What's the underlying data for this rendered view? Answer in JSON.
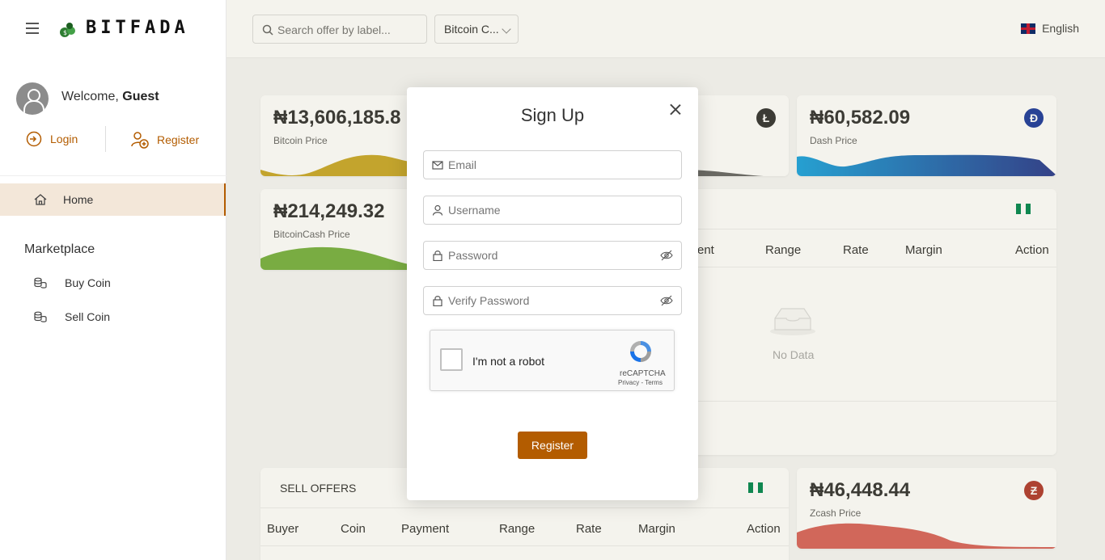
{
  "header": {
    "brand": "BITFADA",
    "search_placeholder": "Search offer by label...",
    "coin_select": "Bitcoin C...",
    "language": "English"
  },
  "sidebar": {
    "welcome_prefix": "Welcome, ",
    "welcome_user": "Guest",
    "login_label": "Login",
    "register_label": "Register",
    "home_label": "Home",
    "marketplace_title": "Marketplace",
    "buy_label": "Buy Coin",
    "sell_label": "Sell Coin"
  },
  "prices": {
    "bitcoin": {
      "value": "₦13,606,185.8",
      "label": "Bitcoin Price"
    },
    "litecoin": {
      "badge": "Ł"
    },
    "dash": {
      "value": "₦60,582.09",
      "label": "Dash Price",
      "badge": "Đ"
    },
    "bitcoincash": {
      "value": "₦214,249.32",
      "label": "BitcoinCash Price"
    },
    "zcash": {
      "value": "₦46,448.44",
      "label": "Zcash Price",
      "badge": "Ƶ"
    }
  },
  "buy_panel": {
    "col_payment_partial": "ent",
    "col_range": "Range",
    "col_rate": "Rate",
    "col_margin": "Margin",
    "col_action": "Action",
    "no_data": "No Data"
  },
  "sell_panel": {
    "title": "SELL OFFERS",
    "col_buyer": "Buyer",
    "col_coin": "Coin",
    "col_payment": "Payment",
    "col_range": "Range",
    "col_rate": "Rate",
    "col_margin": "Margin",
    "col_action": "Action"
  },
  "modal": {
    "title": "Sign Up",
    "email_placeholder": "Email",
    "username_placeholder": "Username",
    "password_placeholder": "Password",
    "verify_placeholder": "Verify Password",
    "captcha_text": "I'm not a robot",
    "captcha_brand": "reCAPTCHA",
    "captcha_terms": "Privacy - Terms",
    "register_button": "Register"
  },
  "colors": {
    "accent": "#b35c00",
    "active_bg": "#f3e7d9"
  }
}
